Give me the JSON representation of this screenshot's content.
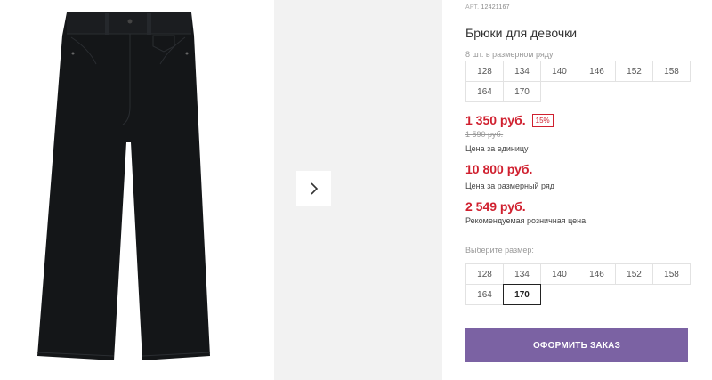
{
  "product": {
    "article_label": "АРТ.",
    "article_code": "12421167",
    "title": "Брюки для девочки",
    "pack_note": "8 шт. в размерном ряду",
    "pack_sizes": [
      "128",
      "134",
      "140",
      "146",
      "152",
      "158",
      "164",
      "170"
    ]
  },
  "pricing": {
    "unit_price": "1 350 руб.",
    "discount": "15%",
    "old_price": "1 590 руб.",
    "unit_caption": "Цена за единицу",
    "row_price": "10 800 руб.",
    "row_caption": "Цена за размерный ряд",
    "rrp_price": "2 549 руб.",
    "rrp_caption": "Рекомендуемая розничная цена"
  },
  "size_selector": {
    "label": "Выберите размер:",
    "sizes": [
      "128",
      "134",
      "140",
      "146",
      "152",
      "158",
      "164",
      "170"
    ],
    "selected": "170"
  },
  "actions": {
    "order_label": "ОФОРМИТЬ ЗАКАЗ"
  },
  "gallery": {
    "next_icon": "chevron-right-icon"
  },
  "colors": {
    "accent_button": "#7b62a3",
    "price_red": "#d0202f"
  }
}
